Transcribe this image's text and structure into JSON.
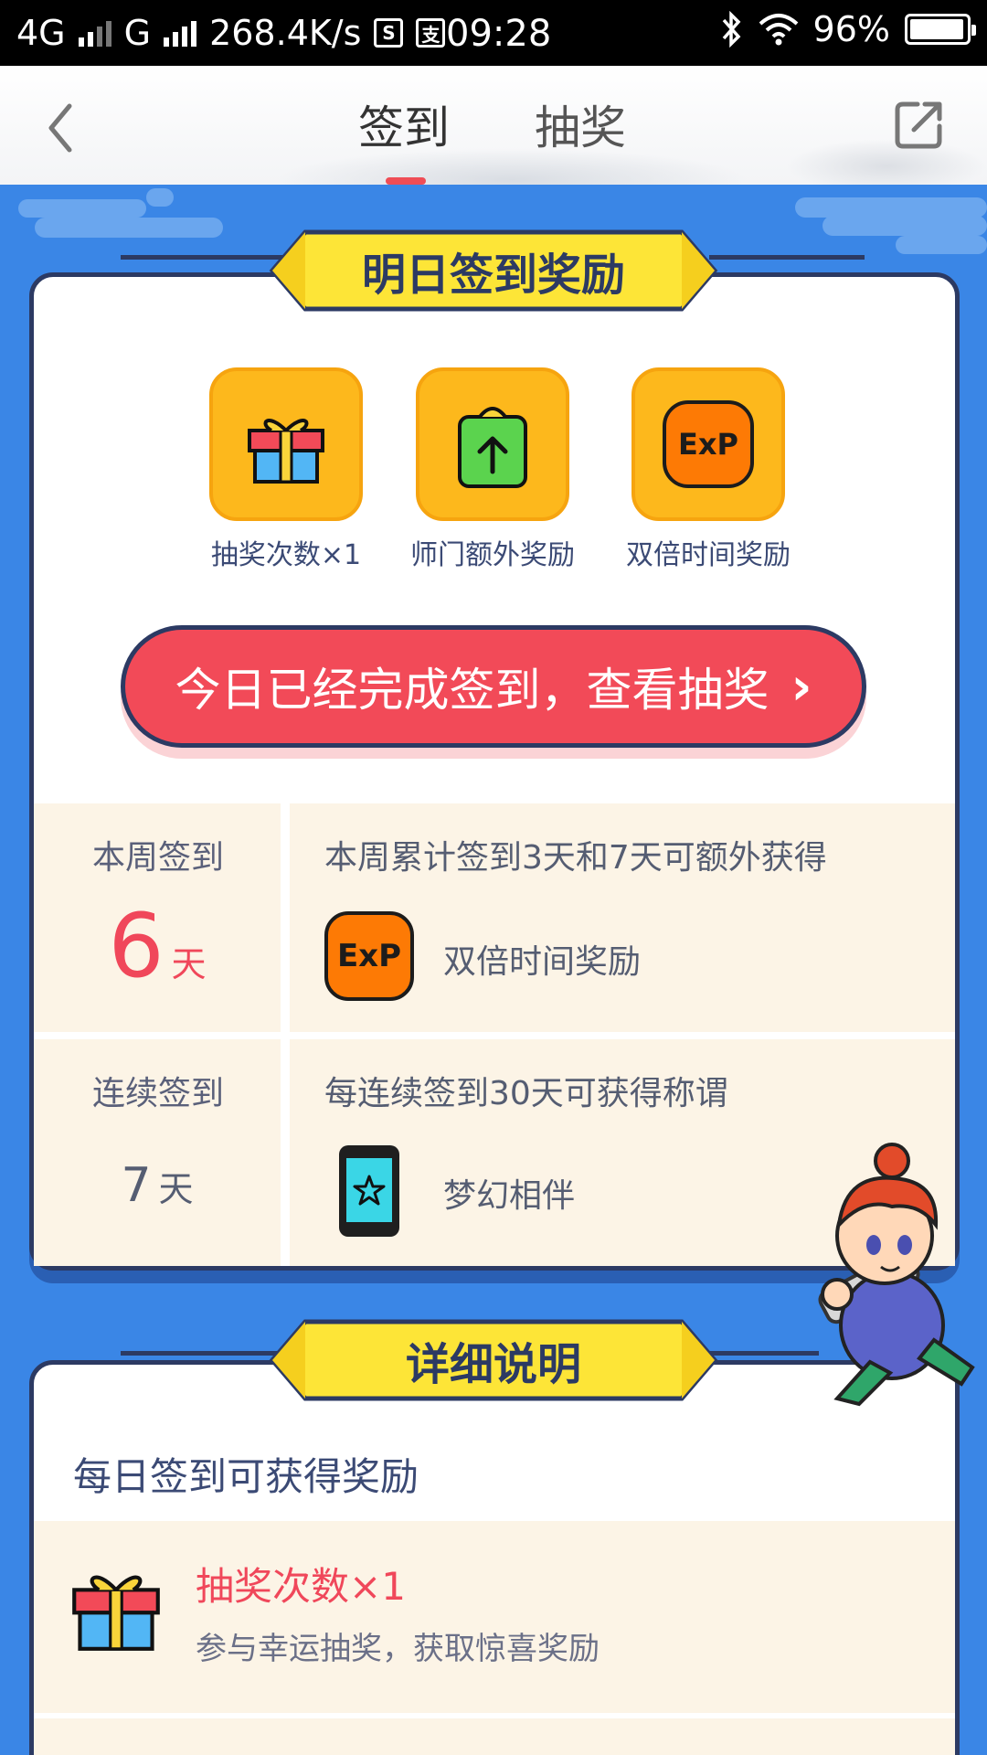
{
  "status_bar": {
    "network1": "4G",
    "network2": "G",
    "speed": "268.4K/s",
    "time": "09:28",
    "battery": "96%",
    "battery_level": 0.96
  },
  "header": {
    "tabs": [
      {
        "label": "签到",
        "active": true
      },
      {
        "label": "抽奖",
        "active": false
      }
    ],
    "back_icon": "chevron-left-icon",
    "share_icon": "share-icon"
  },
  "tomorrow": {
    "title": "明日签到奖励",
    "rewards": [
      {
        "label": "抽奖次数×1",
        "icon": "gift-icon"
      },
      {
        "label": "师门额外奖励",
        "icon": "bag-arrow-icon"
      },
      {
        "label": "双倍时间奖励",
        "icon": "exp-icon"
      }
    ],
    "button_label": "今日已经完成签到，查看抽奖",
    "button_chevron": "›"
  },
  "weekly": {
    "title": "本周签到",
    "count": "6",
    "unit": "天",
    "desc": "本周累计签到3天和7天可额外获得",
    "reward_label": "双倍时间奖励",
    "exp_text": "ExP"
  },
  "streak": {
    "title": "连续签到",
    "count": "7",
    "unit": "天",
    "desc": "每连续签到30天可获得称谓",
    "reward_label": "梦幻相伴"
  },
  "details": {
    "title": "详细说明",
    "section_title": "每日签到可获得奖励",
    "items": [
      {
        "name": "抽奖次数×1",
        "desc": "参与幸运抽奖，获取惊喜奖励",
        "icon": "gift-icon"
      }
    ]
  },
  "colors": {
    "background_blue": "#3a86e6",
    "accent_red": "#f24a58",
    "banner_yellow": "#fde537",
    "reward_orange": "#fdb81c",
    "navy": "#2c3a63"
  }
}
